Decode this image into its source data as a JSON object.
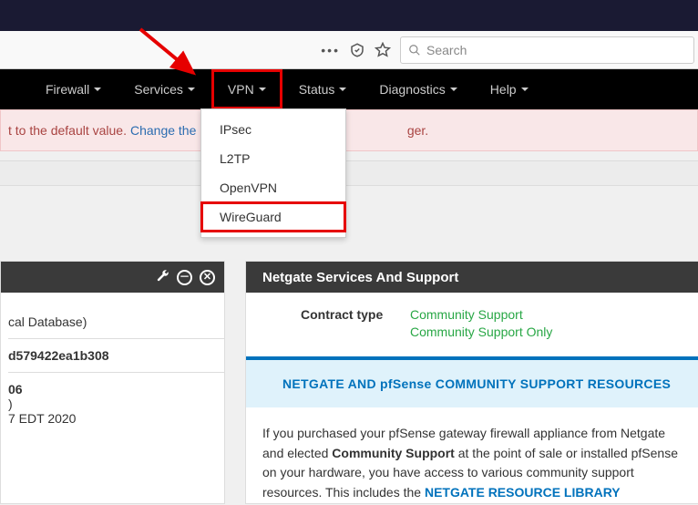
{
  "browser": {
    "search_placeholder": "Search"
  },
  "nav": {
    "items": [
      "Firewall",
      "Services",
      "VPN",
      "Status",
      "Diagnostics",
      "Help"
    ]
  },
  "dropdown": {
    "items": [
      "IPsec",
      "L2TP",
      "OpenVPN",
      "WireGuard"
    ]
  },
  "alert": {
    "pre": "t to the default value.",
    "link": "Change the pa",
    "post": "ger."
  },
  "left": {
    "row1": "cal Database)",
    "row2": "d579422ea1b308",
    "row3a": "06",
    "row3b": ")",
    "row3c": "7 EDT 2020"
  },
  "right": {
    "header": "Netgate Services And Support",
    "contract_label": "Contract type",
    "contract_v1": "Community Support",
    "contract_v2": "Community Support Only",
    "banner": "NETGATE AND pfSense COMMUNITY SUPPORT RESOURCES",
    "p1a": "If you purchased your pfSense gateway firewall appliance from Netgate and",
    "p1b_pre": "elected ",
    "p1b_bold": "Community Support",
    "p1b_post": " at the point of sale or installed pfSense on your",
    "p1c": "hardware, you have access to various community support resources. This includes",
    "p1d_pre": "the ",
    "p1d_link": "NETGATE RESOURCE LIBRARY"
  }
}
